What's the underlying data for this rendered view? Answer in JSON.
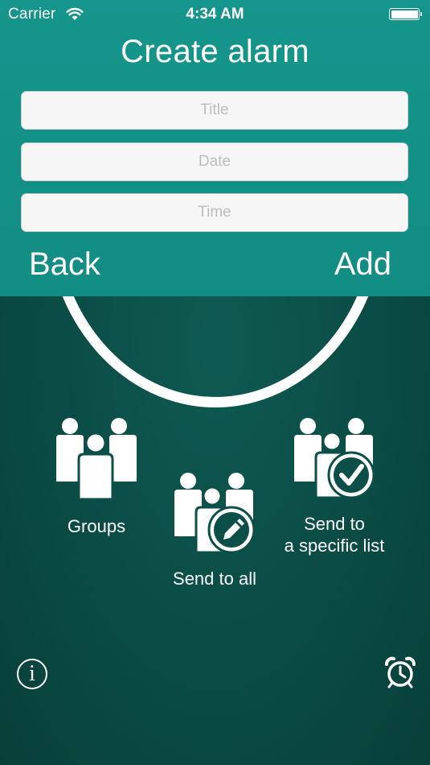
{
  "status_bar": {
    "carrier": "Carrier",
    "time": "4:34 AM"
  },
  "header": {
    "title": "Create alarm"
  },
  "form": {
    "title_placeholder": "Title",
    "date_placeholder": "Date",
    "time_placeholder": "Time"
  },
  "actions": {
    "back_label": "Back",
    "add_label": "Add"
  },
  "options": {
    "groups_label": "Groups",
    "send_all_label": "Send to all",
    "send_list_line1": "Send to",
    "send_list_line2": "a specific list"
  },
  "icons": {
    "wifi": "wifi-icon",
    "battery": "battery-icon",
    "groups": "groups-icon",
    "send_all": "group-edit-icon",
    "send_list": "group-check-icon",
    "info": "info-icon",
    "alarm": "alarm-clock-icon"
  },
  "info_glyph": "i",
  "colors": {
    "panel": "#15958b",
    "background": "#0b4f48",
    "text": "#ffffff",
    "field": "#f6f6f6"
  }
}
